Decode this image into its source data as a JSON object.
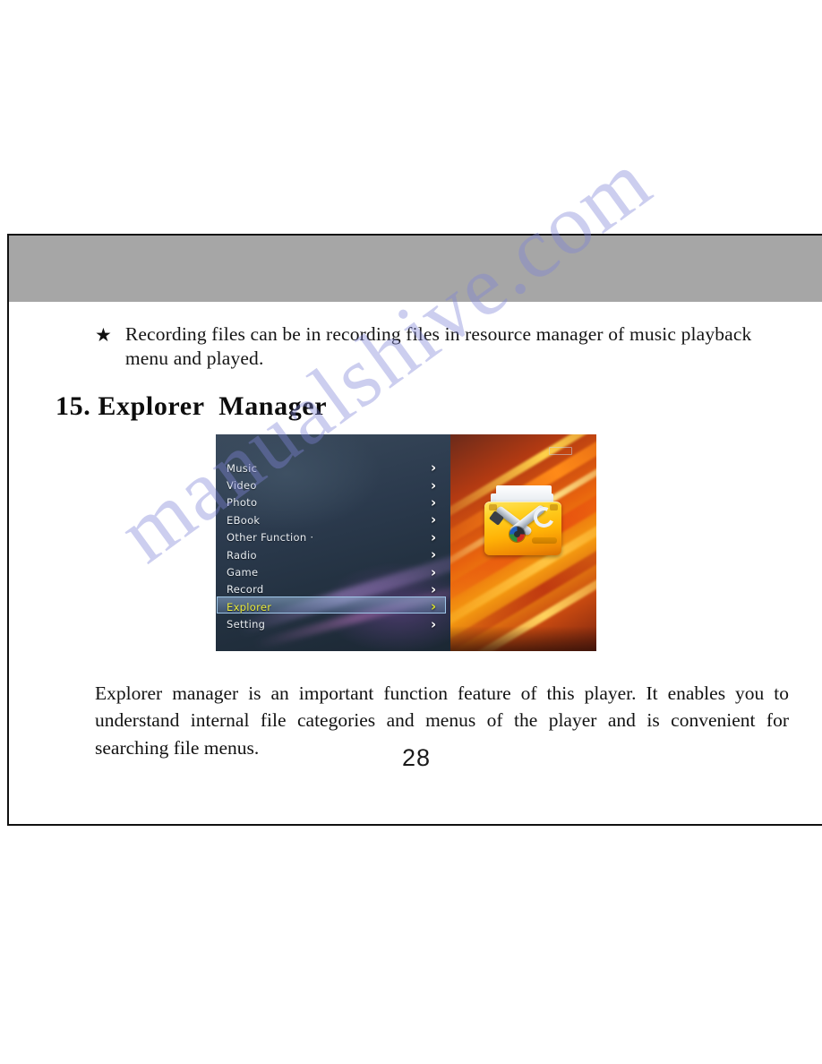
{
  "page": {
    "number": "28",
    "watermark": "manualshive.com"
  },
  "note": {
    "bullet_icon": "star-icon",
    "text": "Recording files can be in recording files in resource manager of music playback menu and played."
  },
  "heading": {
    "text": "15. Explorer  Manager"
  },
  "device_screenshot": {
    "menu_items": [
      {
        "label": "Music",
        "chevron": "›",
        "selected": false
      },
      {
        "label": "Video",
        "chevron": "›",
        "selected": false
      },
      {
        "label": "Photo",
        "chevron": "›",
        "selected": false
      },
      {
        "label": "EBook",
        "chevron": "›",
        "selected": false
      },
      {
        "label": "Other Function ·",
        "chevron": "›",
        "selected": false
      },
      {
        "label": "Radio",
        "chevron": "›",
        "selected": false
      },
      {
        "label": "Game",
        "chevron": "›",
        "selected": false
      },
      {
        "label": "Record",
        "chevron": "›",
        "selected": false
      },
      {
        "label": "Explorer",
        "chevron": "›",
        "selected": true
      },
      {
        "label": "Setting",
        "chevron": "›",
        "selected": false
      }
    ],
    "selected_item": "Explorer",
    "icon_name": "folder-tools-icon",
    "status_icon": "battery-icon",
    "colors": {
      "selected_text": "#eaea3c",
      "item_text": "#e8edf2",
      "panel_left": "#2b3a4d",
      "panel_right": "#e8630e",
      "folder": "#ffd021"
    }
  },
  "body": {
    "paragraph": "Explorer manager is an important function feature of this player.  It enables you to understand internal file categories and menus of the player and is convenient for searching file menus."
  }
}
